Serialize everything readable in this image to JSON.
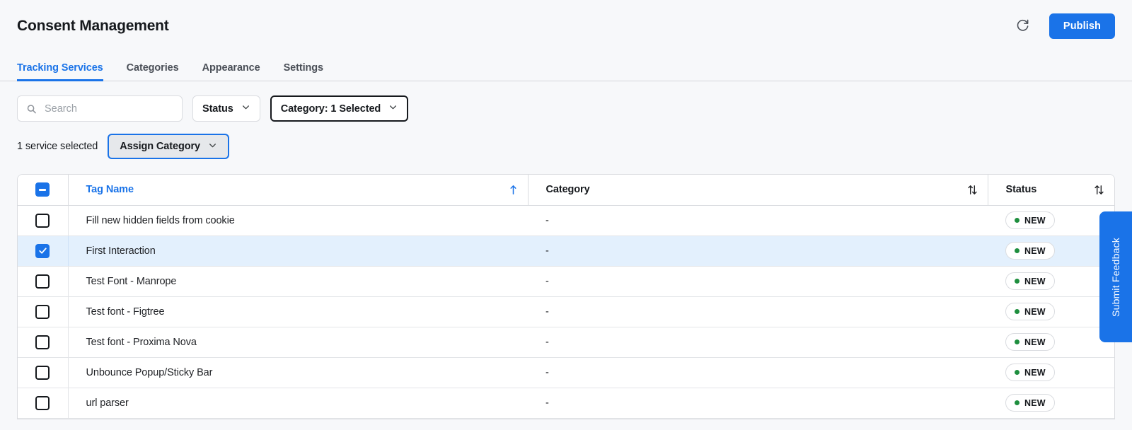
{
  "header": {
    "title": "Consent Management",
    "refresh_icon": "refresh-icon",
    "publish_label": "Publish"
  },
  "tabs": [
    {
      "label": "Tracking Services",
      "active": true
    },
    {
      "label": "Categories",
      "active": false
    },
    {
      "label": "Appearance",
      "active": false
    },
    {
      "label": "Settings",
      "active": false
    }
  ],
  "filters": {
    "search": {
      "value": "",
      "placeholder": "Search",
      "icon": "search-icon"
    },
    "status": {
      "label": "Status",
      "icon": "chevron-down-icon",
      "selected": false
    },
    "category": {
      "label": "Category: 1 Selected",
      "icon": "chevron-down-icon",
      "selected": true
    }
  },
  "selection": {
    "count_label": "1 service selected",
    "assign_label": "Assign Category",
    "assign_icon": "chevron-down-icon"
  },
  "table": {
    "header_checkbox_state": "indeterminate",
    "columns": [
      {
        "label": "Tag Name",
        "sort": "asc",
        "sort_icon": "sort-asc-icon"
      },
      {
        "label": "Category",
        "sort": "none",
        "sort_icon": "sort-updown-icon"
      },
      {
        "label": "Status",
        "sort": "none",
        "sort_icon": "sort-updown-icon"
      }
    ],
    "rows": [
      {
        "checked": false,
        "tag_name": "Fill new hidden fields from cookie",
        "category": "-",
        "status": "NEW"
      },
      {
        "checked": true,
        "tag_name": "First Interaction",
        "category": "-",
        "status": "NEW"
      },
      {
        "checked": false,
        "tag_name": "Test Font - Manrope",
        "category": "-",
        "status": "NEW"
      },
      {
        "checked": false,
        "tag_name": "Test font - Figtree",
        "category": "-",
        "status": "NEW"
      },
      {
        "checked": false,
        "tag_name": "Test font - Proxima Nova",
        "category": "-",
        "status": "NEW"
      },
      {
        "checked": false,
        "tag_name": "Unbounce Popup/Sticky Bar",
        "category": "-",
        "status": "NEW"
      },
      {
        "checked": false,
        "tag_name": "url parser",
        "category": "-",
        "status": "NEW"
      }
    ]
  },
  "feedback": {
    "label": "Submit Feedback"
  },
  "colors": {
    "accent": "#1a73e8",
    "page_bg": "#f7f8fa",
    "selected_row": "#e3f0fd",
    "status_dot": "#1e8e3e",
    "border": "#dadce0"
  }
}
